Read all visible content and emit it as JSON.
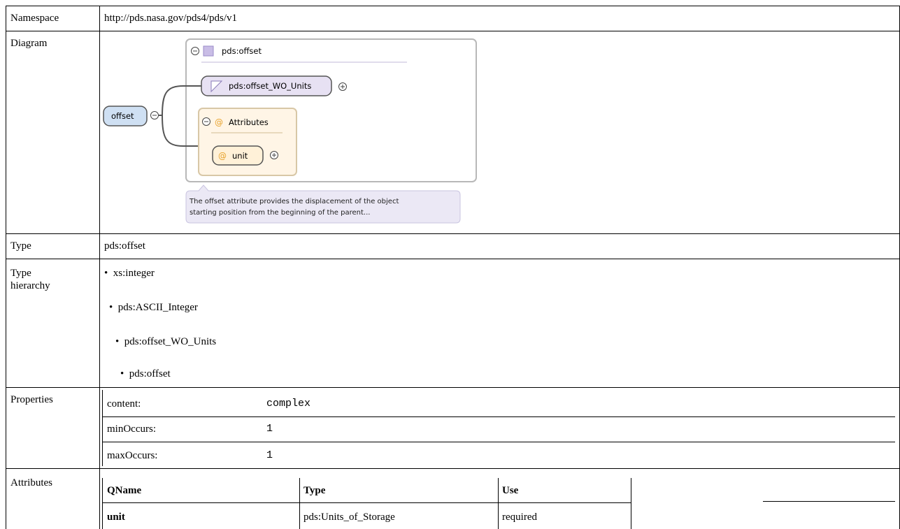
{
  "rows": {
    "namespace": {
      "label": "Namespace",
      "value": "http://pds.nasa.gov/pds4/pds/v1"
    },
    "diagram": {
      "label": "Diagram",
      "element": "offset",
      "type_name": "pds:offset",
      "base_type": "pds:offset_WO_Units",
      "attributes_label": "Attributes",
      "attribute": "unit",
      "note_line1": "The offset attribute provides the displacement of the object",
      "note_line2": "starting position from the beginning of the parent..."
    },
    "type": {
      "label": "Type",
      "value": "pds:offset"
    },
    "type_hierarchy": {
      "label_line1": "Type",
      "label_line2": "hierarchy",
      "items": [
        "xs:integer",
        "pds:ASCII_Integer",
        "pds:offset_WO_Units",
        "pds:offset"
      ]
    },
    "properties": {
      "label": "Properties",
      "items": [
        {
          "key": "content:",
          "value": "complex"
        },
        {
          "key": "minOccurs:",
          "value": "1"
        },
        {
          "key": "maxOccurs:",
          "value": "1"
        }
      ]
    },
    "attributes": {
      "label": "Attributes",
      "headers": [
        "QName",
        "Type",
        "Use"
      ],
      "rows": [
        {
          "qname": "unit",
          "type": "pds:Units_of_Storage",
          "use": "required"
        }
      ]
    }
  },
  "colors": {
    "border": "#000000",
    "element_fill": "#cfe0f3",
    "type_fill": "#e7e1f3",
    "attribute_fill": "#fff1d8",
    "note_fill": "#ebe8f5"
  }
}
